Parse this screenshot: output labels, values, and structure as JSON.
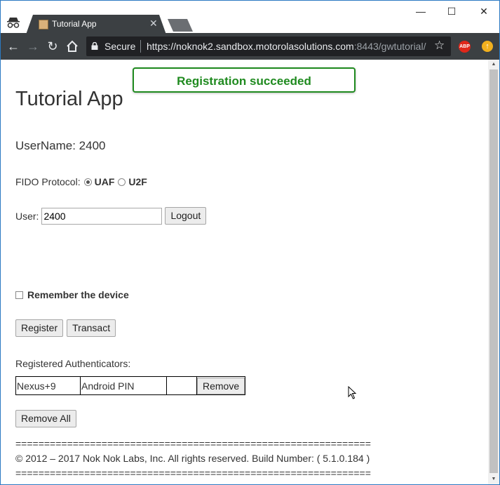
{
  "browser": {
    "tab_title": "Tutorial App",
    "secure_label": "Secure",
    "url_main": "https://noknok2.sandbox.motorolasolutions.com",
    "url_rest": ":8443/gwtutorial/",
    "extension_abp_label": "ABP"
  },
  "toast": {
    "message": "Registration succeeded",
    "color": "#1f8a1f"
  },
  "page": {
    "title": "Tutorial App",
    "username_line": "UserName: 2400",
    "fido_label": "FIDO Protocol:",
    "fido_options": [
      {
        "label": "UAF",
        "selected": true
      },
      {
        "label": "U2F",
        "selected": false
      }
    ],
    "user_label": "User:",
    "user_value": "2400",
    "logout_label": "Logout",
    "remember_label": "Remember the device",
    "register_label": "Register",
    "transact_label": "Transact",
    "registered_label": "Registered Authenticators:",
    "authenticators": [
      {
        "device": "Nexus+9",
        "type": "Android PIN",
        "extra": "",
        "remove_label": "Remove"
      }
    ],
    "remove_all_label": "Remove All",
    "footer_rule": "==============================================================",
    "footer_text": "© 2012 – 2017 Nok Nok Labs, Inc. All rights reserved. Build Number: ( 5.1.0.184 )"
  }
}
